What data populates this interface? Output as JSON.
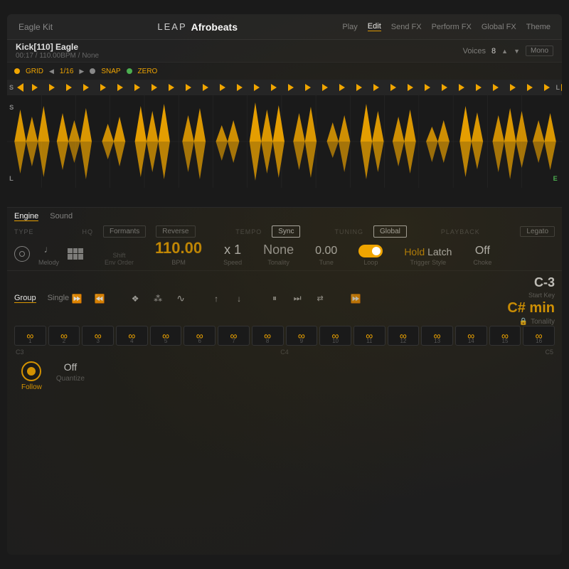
{
  "app": {
    "title_leap": "LEAP",
    "title_name": "Afrobeats",
    "kit_name": "Eagle Kit"
  },
  "nav": {
    "items": [
      "Play",
      "Edit",
      "Send FX",
      "Perform FX",
      "Global FX",
      "Theme"
    ],
    "active": "Edit"
  },
  "instrument": {
    "name": "Kick[110] Eagle",
    "meta": "00:17 / 110.00BPM / None",
    "voices_label": "Voices",
    "voices_value": "8",
    "mono_label": "Mono"
  },
  "grid": {
    "grid_label": "GRID",
    "grid_value": "1/16",
    "snap_label": "SNAP",
    "zero_label": "ZERO"
  },
  "engine": {
    "tabs": [
      "Engine",
      "Sound"
    ],
    "active_tab": "Engine",
    "type_label": "TYPE",
    "hq_label": "HQ",
    "formants_label": "Formants",
    "reverse_label": "Reverse",
    "tempo_label": "TEMPO",
    "sync_label": "Sync",
    "tuning_label": "TUNING",
    "global_label": "Global",
    "playback_label": "PLAYBACK",
    "legato_label": "Legato",
    "bpm_value": "110.00",
    "bpm_label": "BPM",
    "speed_value": "x 1",
    "speed_label": "Speed",
    "tonality_value": "None",
    "tonality_label": "Tonality",
    "tune_value": "0.00",
    "tune_label": "Tune",
    "loop_label": "Loop",
    "hold_label": "Hold",
    "latch_label": "Latch",
    "trigger_label": "Trigger Style",
    "choke_value": "Off",
    "choke_label": "Choke",
    "melody_label": "Melody",
    "shift_label": "Shift",
    "env_order_label": "Env Order"
  },
  "group": {
    "tabs": [
      "Group",
      "Single"
    ],
    "active_tab": "Group",
    "start_key_value": "C-3",
    "start_key_label": "Start Key",
    "tonality_value": "C# min",
    "tonality_label": "Tonality",
    "pads": [
      {
        "number": "1",
        "note": "C3"
      },
      {
        "number": "2",
        "note": ""
      },
      {
        "number": "3",
        "note": ""
      },
      {
        "number": "4",
        "note": ""
      },
      {
        "number": "5",
        "note": ""
      },
      {
        "number": "6",
        "note": ""
      },
      {
        "number": "7",
        "note": ""
      },
      {
        "number": "8",
        "note": ""
      },
      {
        "number": "9",
        "note": ""
      },
      {
        "number": "10",
        "note": ""
      },
      {
        "number": "11",
        "note": ""
      },
      {
        "number": "12",
        "note": ""
      },
      {
        "number": "13",
        "note": ""
      },
      {
        "number": "14",
        "note": ""
      },
      {
        "number": "15",
        "note": ""
      },
      {
        "number": "16",
        "note": "C5"
      }
    ],
    "pad_labels": [
      "C3",
      "C4",
      "C5"
    ],
    "follow_label": "Follow",
    "quantize_label": "Quantize",
    "quantize_value": "Off"
  },
  "colors": {
    "accent": "#f0a500",
    "bg_dark": "#1a1a1a",
    "bg_medium": "#1e1e1e",
    "bg_light": "#252525",
    "text_primary": "#e0e0e0",
    "text_secondary": "#888888",
    "text_dim": "#555555",
    "green": "#4caf50"
  }
}
